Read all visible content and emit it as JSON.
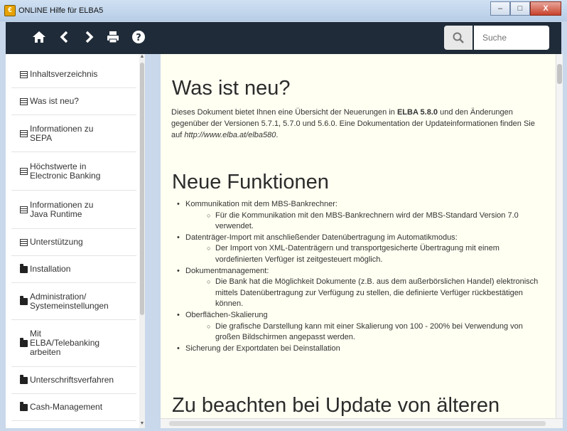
{
  "window": {
    "title": "ONLINE Hilfe für ELBA5",
    "minimize": "–",
    "maximize": "□",
    "close": "X"
  },
  "toolbar": {
    "icons": [
      "home-icon",
      "back-icon",
      "forward-icon",
      "print-icon",
      "help-icon"
    ],
    "search_placeholder": "Suche"
  },
  "sidebar": {
    "items": [
      {
        "label": "Inhaltsverzeichnis",
        "icon": "page-icon"
      },
      {
        "label": "Was ist neu?",
        "icon": "page-icon"
      },
      {
        "label": "Informationen zu SEPA",
        "icon": "page-icon"
      },
      {
        "label": "Höchstwerte in Electronic Banking",
        "icon": "page-icon"
      },
      {
        "label": "Informationen zu Java Runtime",
        "icon": "page-icon"
      },
      {
        "label": "Unterstützung",
        "icon": "page-icon"
      },
      {
        "label": "Installation",
        "icon": "folder-icon"
      },
      {
        "label": "Administration/ Systemeinstellungen",
        "icon": "folder-icon"
      },
      {
        "label": "Mit ELBA/Telebanking arbeiten",
        "icon": "folder-icon"
      },
      {
        "label": "Unterschriftsverfahren",
        "icon": "folder-icon"
      },
      {
        "label": "Cash-Management",
        "icon": "folder-icon"
      }
    ]
  },
  "content": {
    "heading1": "Was ist neu?",
    "intro": {
      "before": "Dieses Dokument bietet Ihnen eine Übersicht der Neuerungen in ",
      "bold": "ELBA 5.8.0",
      "middle": " und den Änderungen gegenüber der Versionen 5.7.1, 5.7.0 und 5.6.0. Eine Dokumentation der Updateinformationen finden Sie auf ",
      "link": "http://www.elba.at/elba580",
      "after": "."
    },
    "heading2": "Neue Funktionen",
    "features": [
      {
        "text": "Kommunikation mit dem MBS-Bankrechner:",
        "sub": "Für die Kommunikation mit den MBS-Bankrechnern wird der MBS-Standard Version 7.0 verwendet."
      },
      {
        "text": "Datenträger-Import mit anschließender Datenübertragung im Automatikmodus:",
        "sub": "Der Import von XML-Datenträgern und transportgesicherte Übertragung mit einem vordefinierten Verfüger ist zeitgesteuert möglich."
      },
      {
        "text": "Dokumentmanagement:",
        "sub": "Die Bank hat die Möglichkeit Dokumente (z.B. aus dem außerbörslichen Handel) elektronisch mittels Datenübertragung zur Verfügung zu stellen, die definierte Verfüger rückbestätigen können."
      },
      {
        "text": "Oberflächen-Skalierung",
        "sub": "Die grafische Darstellung kann mit einer Skalierung von 100 - 200%  bei Verwendung von großen Bildschirmen angepasst werden."
      },
      {
        "text": "Sicherung der Exportdaten bei Deinstallation",
        "sub": null
      }
    ],
    "heading3": "Zu beachten bei Update von älteren"
  }
}
